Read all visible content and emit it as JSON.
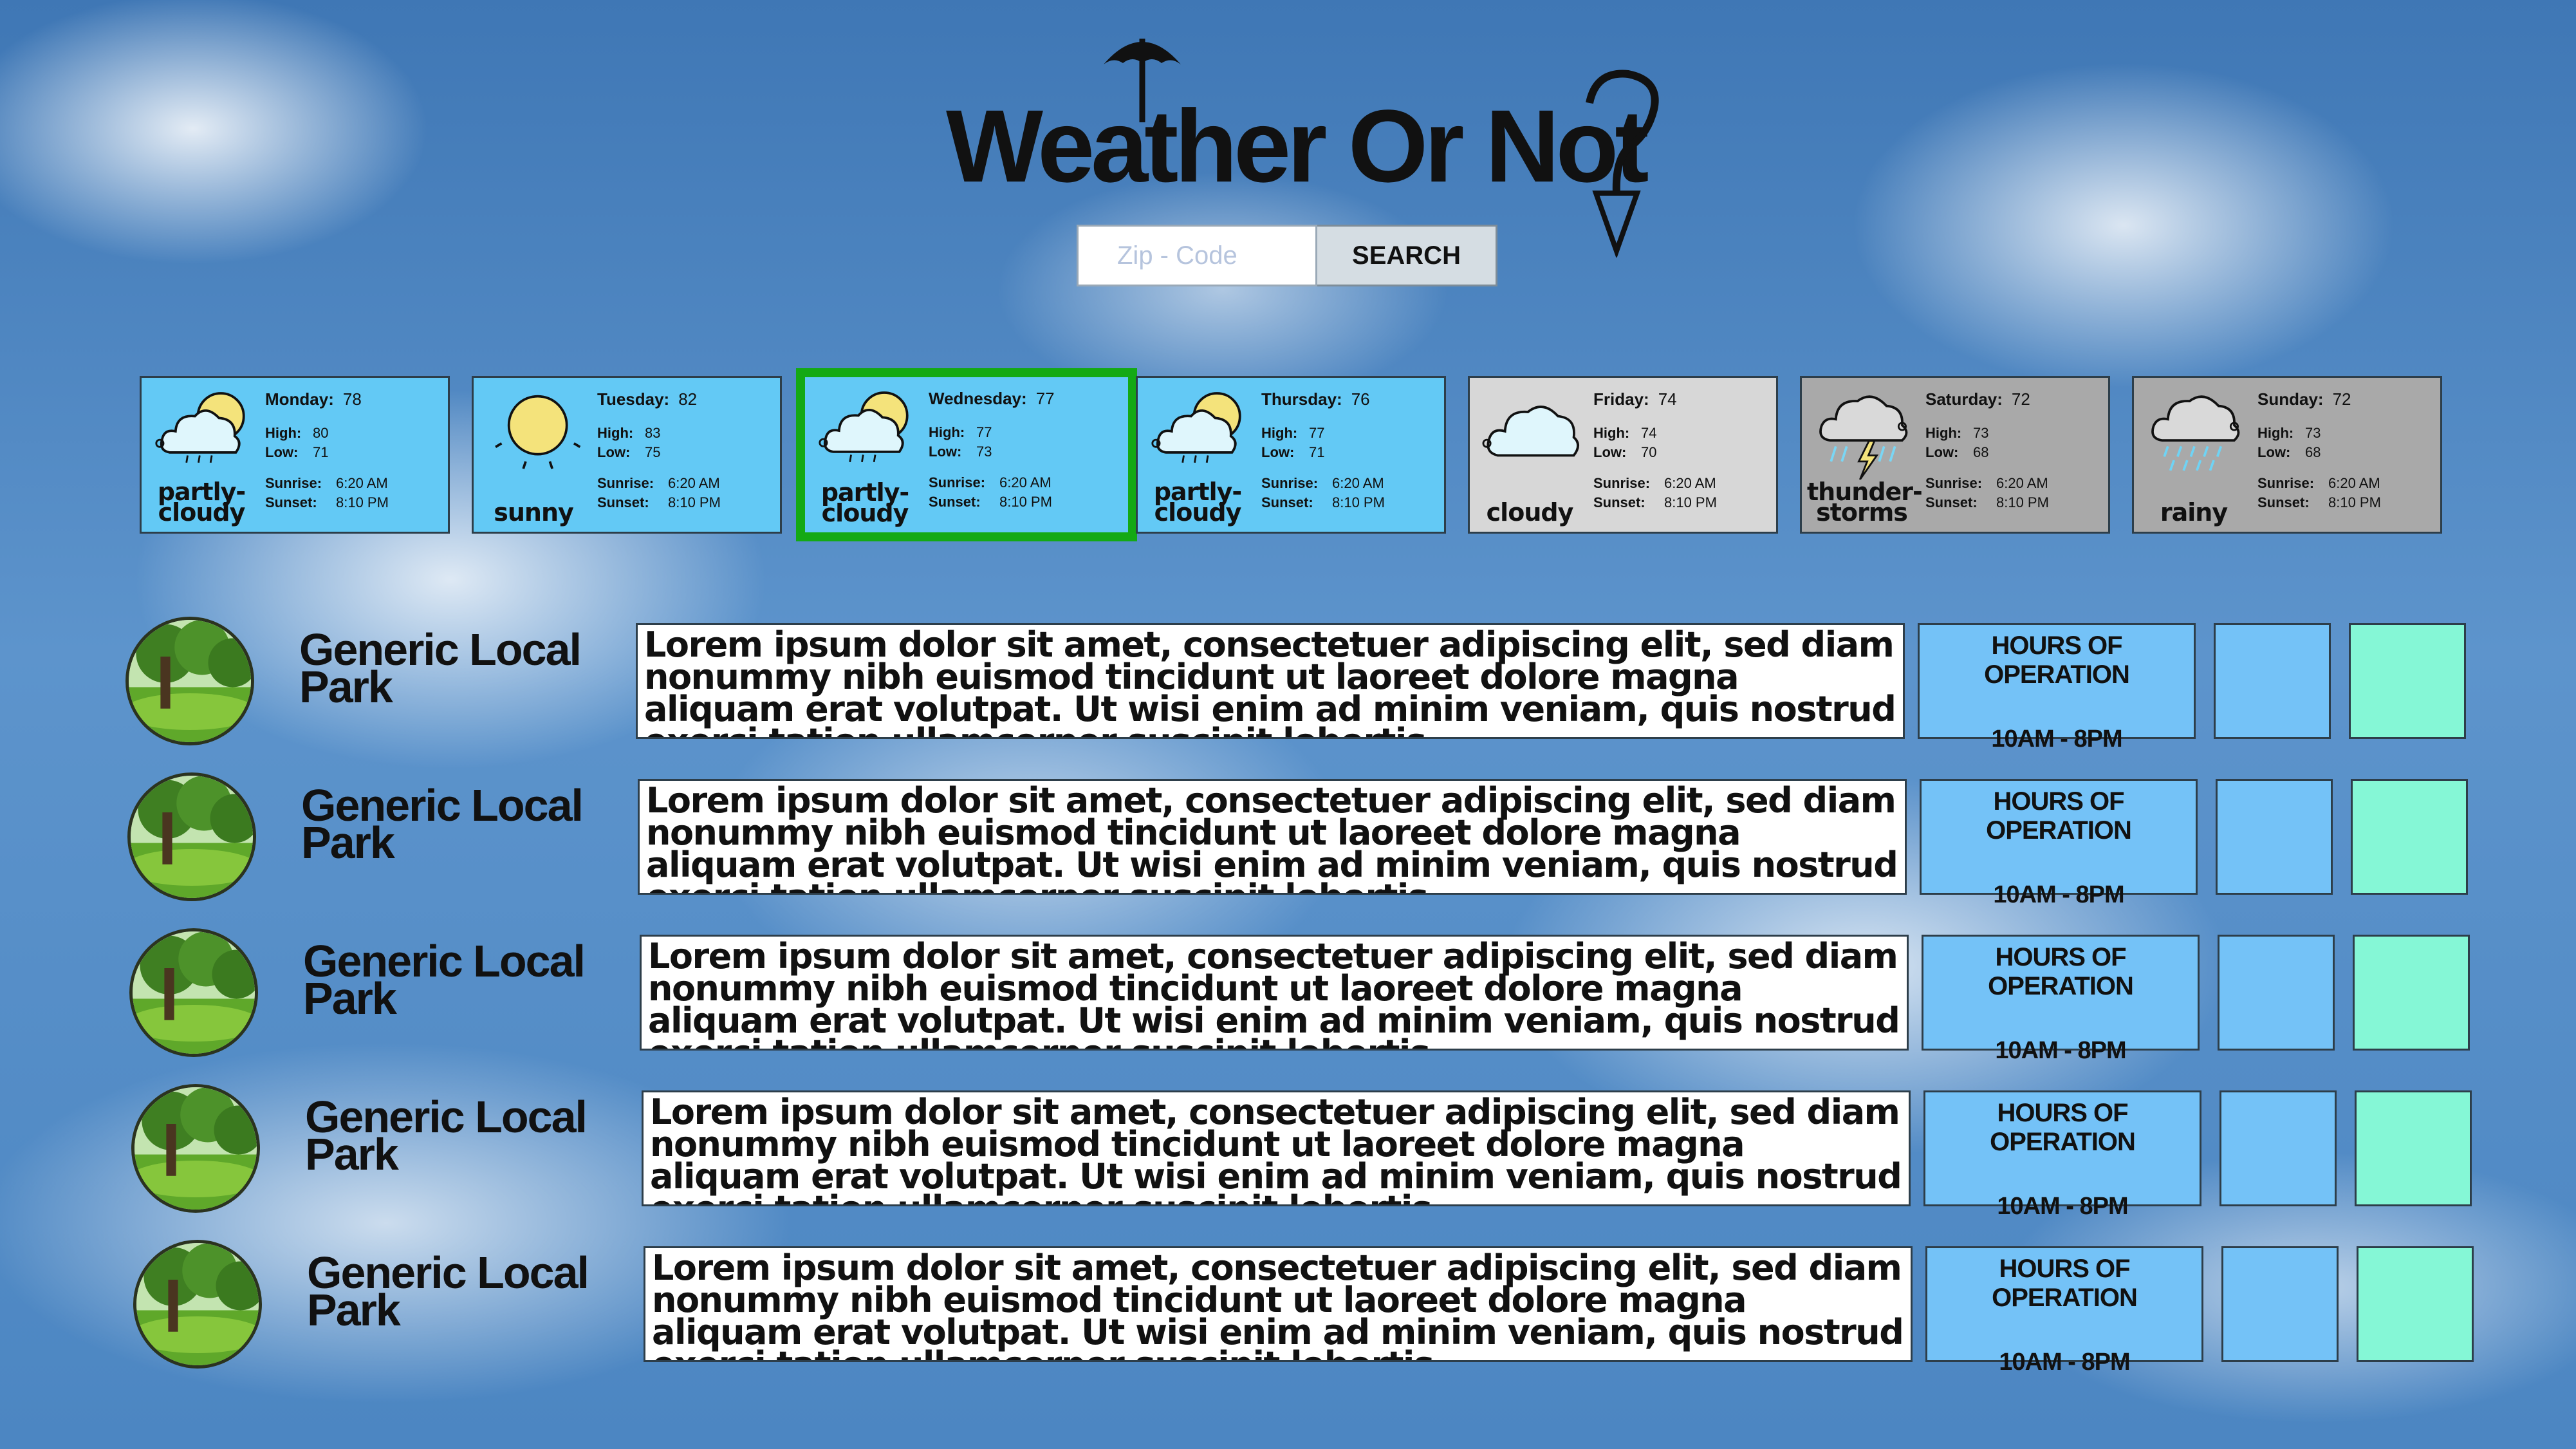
{
  "header": {
    "logo_text": "Weather Or Not",
    "search": {
      "placeholder": "Zip - Code",
      "value": "",
      "button_label": "SEARCH"
    }
  },
  "forecast": [
    {
      "day": "Monday:",
      "temp": "78",
      "high_label": "High:",
      "high": "80",
      "low_label": "Low:",
      "low": "71",
      "sunrise_label": "Sunrise:",
      "sunrise": "6:20 AM",
      "sunset_label": "Sunset:",
      "sunset": "8:10 PM",
      "condition_line1": "partly-",
      "condition_line2": "cloudy",
      "icon": "partly-cloudy-icon",
      "bg": "#63c9f5",
      "selected": false
    },
    {
      "day": "Tuesday:",
      "temp": "82",
      "high_label": "High:",
      "high": "83",
      "low_label": "Low:",
      "low": "75",
      "sunrise_label": "Sunrise:",
      "sunrise": "6:20 AM",
      "sunset_label": "Sunset:",
      "sunset": "8:10 PM",
      "condition_line1": "sunny",
      "condition_line2": "",
      "icon": "sunny-icon",
      "bg": "#63c9f5",
      "selected": false
    },
    {
      "day": "Wednesday:",
      "temp": "77",
      "high_label": "High:",
      "high": "77",
      "low_label": "Low:",
      "low": "73",
      "sunrise_label": "Sunrise:",
      "sunrise": "6:20 AM",
      "sunset_label": "Sunset:",
      "sunset": "8:10 PM",
      "condition_line1": "partly-",
      "condition_line2": "cloudy",
      "icon": "partly-cloudy-icon",
      "bg": "#63c9f5",
      "selected": true
    },
    {
      "day": "Thursday:",
      "temp": "76",
      "high_label": "High:",
      "high": "77",
      "low_label": "Low:",
      "low": "71",
      "sunrise_label": "Sunrise:",
      "sunrise": "6:20 AM",
      "sunset_label": "Sunset:",
      "sunset": "8:10 PM",
      "condition_line1": "partly-",
      "condition_line2": "cloudy",
      "icon": "partly-cloudy-icon",
      "bg": "#63c9f5",
      "selected": false
    },
    {
      "day": "Friday:",
      "temp": "74",
      "high_label": "High:",
      "high": "74",
      "low_label": "Low:",
      "low": "70",
      "sunrise_label": "Sunrise:",
      "sunrise": "6:20 AM",
      "sunset_label": "Sunset:",
      "sunset": "8:10 PM",
      "condition_line1": "cloudy",
      "condition_line2": "",
      "icon": "cloudy-icon",
      "bg": "#d7d7d7",
      "selected": false
    },
    {
      "day": "Saturday:",
      "temp": "72",
      "high_label": "High:",
      "high": "73",
      "low_label": "Low:",
      "low": "68",
      "sunrise_label": "Sunrise:",
      "sunrise": "6:20 AM",
      "sunset_label": "Sunset:",
      "sunset": "8:10 PM",
      "condition_line1": "thunder-",
      "condition_line2": "storms",
      "icon": "thunderstorm-icon",
      "bg": "#a9a9a9",
      "selected": false
    },
    {
      "day": "Sunday:",
      "temp": "72",
      "high_label": "High:",
      "high": "73",
      "low_label": "Low:",
      "low": "68",
      "sunrise_label": "Sunrise:",
      "sunrise": "6:20 AM",
      "sunset_label": "Sunset:",
      "sunset": "8:10 PM",
      "condition_line1": "rainy",
      "condition_line2": "",
      "icon": "rainy-icon",
      "bg": "#a9a9a9",
      "selected": false
    }
  ],
  "parks": [
    {
      "name": "Generic Local Park",
      "description": "Lorem ipsum dolor sit amet, consectetuer adipiscing elit, sed diam nonummy nibh euismod tincidunt ut laoreet dolore magna aliquam erat volutpat. Ut wisi enim ad minim veniam, quis nostrud exerci tation ullamcorper suscipit lobortis",
      "hours_title": "HOURS OF OPERATION",
      "hours": "10AM - 8PM"
    },
    {
      "name": "Generic Local Park",
      "description": "Lorem ipsum dolor sit amet, consectetuer adipiscing elit, sed diam nonummy nibh euismod tincidunt ut laoreet dolore magna aliquam erat volutpat. Ut wisi enim ad minim veniam, quis nostrud exerci tation ullamcorper suscipit lobortis",
      "hours_title": "HOURS OF OPERATION",
      "hours": "10AM - 8PM"
    },
    {
      "name": "Generic Local Park",
      "description": "Lorem ipsum dolor sit amet, consectetuer adipiscing elit, sed diam nonummy nibh euismod tincidunt ut laoreet dolore magna aliquam erat volutpat. Ut wisi enim ad minim veniam, quis nostrud exerci tation ullamcorper suscipit lobortis",
      "hours_title": "HOURS OF OPERATION",
      "hours": "10AM - 8PM"
    },
    {
      "name": "Generic Local Park",
      "description": "Lorem ipsum dolor sit amet, consectetuer adipiscing elit, sed diam nonummy nibh euismod tincidunt ut laoreet dolore magna aliquam erat volutpat. Ut wisi enim ad minim veniam, quis nostrud exerci tation ullamcorper suscipit lobortis",
      "hours_title": "HOURS OF OPERATION",
      "hours": "10AM - 8PM"
    },
    {
      "name": "Generic Local Park",
      "description": "Lorem ipsum dolor sit amet, consectetuer adipiscing elit, sed diam nonummy nibh euismod tincidunt ut laoreet dolore magna aliquam erat volutpat. Ut wisi enim ad minim veniam, quis nostrud exerci tation ullamcorper suscipit lobortis",
      "hours_title": "HOURS OF OPERATION",
      "hours": "10AM - 8PM"
    }
  ],
  "colors": {
    "sky_blue_card": "#63c9f5",
    "selected_border": "#14a914",
    "hours_box": "#74c2f7",
    "mint_box": "#85f7d6"
  }
}
